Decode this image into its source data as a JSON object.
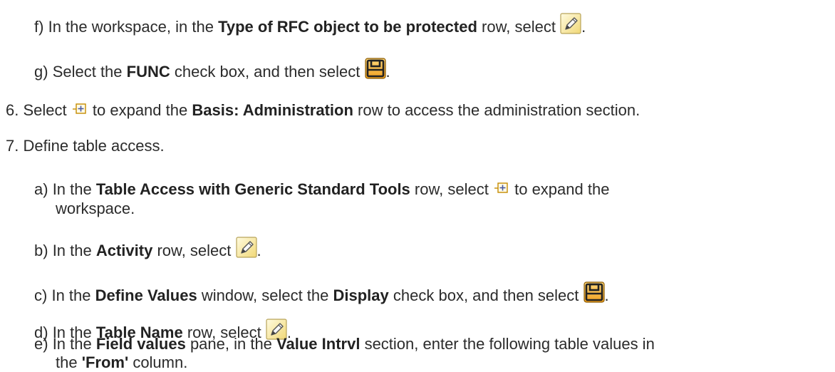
{
  "step_f": {
    "marker": "f)",
    "pre": "In the workspace, in the",
    "bold": "Type of RFC object to be protected",
    "post": "row, select",
    "end": ".",
    "icon": "pencil-icon"
  },
  "step_g": {
    "marker": "g)",
    "pre": "Select the",
    "bold": "FUNC",
    "post": "check box, and then select",
    "end": ".",
    "icon": "save-icon"
  },
  "step_6": {
    "marker": "6.",
    "pre": "Select",
    "post1": "to expand the",
    "bold": "Basis: Administration",
    "post2": "row to access the administration section.",
    "icon": "expand-icon"
  },
  "step_7": {
    "marker": "7.",
    "text": "Define table access."
  },
  "step_7a": {
    "marker": "a)",
    "pre": "In the",
    "bold": "Table Access with Generic Standard Tools",
    "post1": "row, select",
    "post2": "to expand the",
    "wrap": "workspace.",
    "icon": "expand-icon"
  },
  "step_7b": {
    "marker": "b)",
    "pre": "In the",
    "bold": "Activity",
    "post": "row, select",
    "end": ".",
    "icon": "pencil-icon"
  },
  "step_7c": {
    "marker": "c)",
    "pre": "In the",
    "bold1": "Define Values",
    "mid": "window, select the",
    "bold2": "Display",
    "post": "check box, and then select",
    "end": ".",
    "icon": "save-icon"
  },
  "step_7d": {
    "marker": "d)",
    "pre": "In the",
    "bold": "Table Name",
    "post": "row, select",
    "end": ".",
    "icon": "pencil-icon"
  },
  "step_7e": {
    "marker": "e)",
    "pre": "In the",
    "bold1": "Field values",
    "mid1": "pane, in the",
    "bold2": "Value Intrvl",
    "mid2": "section, enter the following table values in",
    "wrap_pre": "the",
    "bold3": "'From'",
    "wrap_post": "column."
  }
}
